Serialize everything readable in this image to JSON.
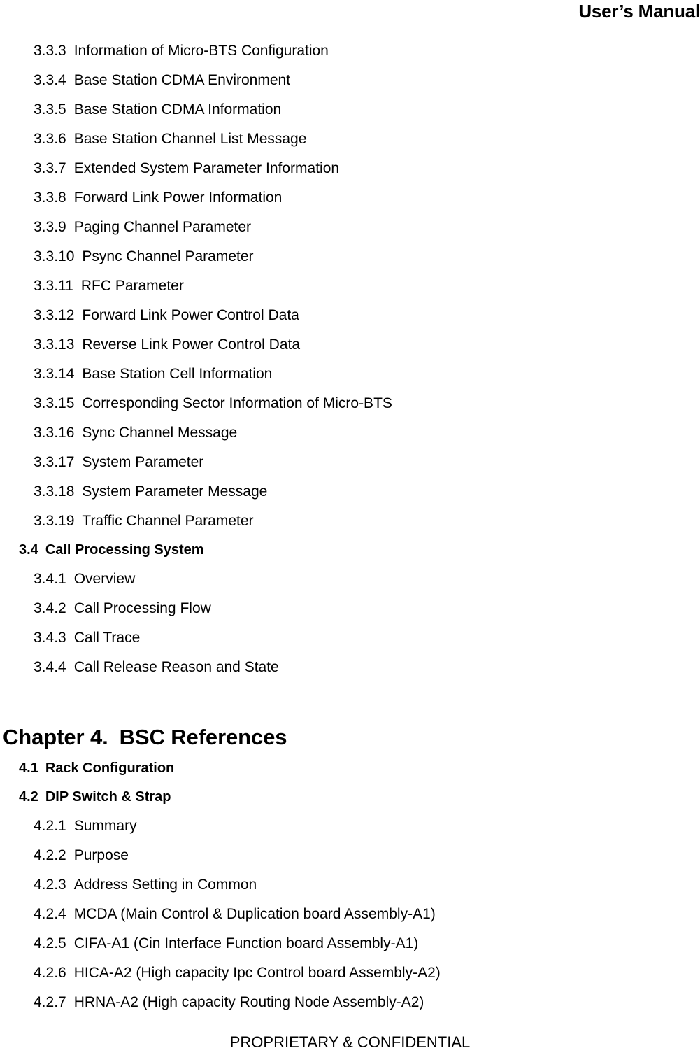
{
  "header": {
    "title": "User’s Manual"
  },
  "toc": {
    "entries": [
      {
        "level": 3,
        "num": "3.3.3",
        "title": "Information of Micro-BTS Configuration"
      },
      {
        "level": 3,
        "num": "3.3.4",
        "title": "Base Station CDMA Environment"
      },
      {
        "level": 3,
        "num": "3.3.5",
        "title": "Base Station CDMA Information"
      },
      {
        "level": 3,
        "num": "3.3.6",
        "title": "Base Station Channel List Message"
      },
      {
        "level": 3,
        "num": "3.3.7",
        "title": "Extended System Parameter Information"
      },
      {
        "level": 3,
        "num": "3.3.8",
        "title": "Forward Link Power Information"
      },
      {
        "level": 3,
        "num": "3.3.9",
        "title": "Paging Channel Parameter"
      },
      {
        "level": 3,
        "num": "3.3.10",
        "title": "Psync Channel Parameter"
      },
      {
        "level": 3,
        "num": "3.3.11",
        "title": "RFC Parameter"
      },
      {
        "level": 3,
        "num": "3.3.12",
        "title": "Forward Link Power Control Data"
      },
      {
        "level": 3,
        "num": "3.3.13",
        "title": "Reverse Link Power Control Data"
      },
      {
        "level": 3,
        "num": "3.3.14",
        "title": "Base Station Cell Information"
      },
      {
        "level": 3,
        "num": "3.3.15",
        "title": "Corresponding Sector Information of Micro-BTS"
      },
      {
        "level": 3,
        "num": "3.3.16",
        "title": "Sync Channel Message"
      },
      {
        "level": 3,
        "num": "3.3.17",
        "title": "System Parameter"
      },
      {
        "level": 3,
        "num": "3.3.18",
        "title": "System Parameter Message"
      },
      {
        "level": 3,
        "num": "3.3.19",
        "title": "Traffic Channel Parameter"
      },
      {
        "level": 2,
        "num": "3.4",
        "title": "Call Processing System"
      },
      {
        "level": 3,
        "num": "3.4.1",
        "title": "Overview"
      },
      {
        "level": 3,
        "num": "3.4.2",
        "title": "Call Processing Flow"
      },
      {
        "level": 3,
        "num": "3.4.3",
        "title": "Call Trace"
      },
      {
        "level": 3,
        "num": "3.4.4",
        "title": "Call Release Reason and State"
      },
      {
        "level": 1,
        "num": "Chapter 4.",
        "title": "BSC References"
      },
      {
        "level": 2,
        "num": "4.1",
        "title": "Rack Configuration"
      },
      {
        "level": 2,
        "num": "4.2",
        "title": "DIP Switch & Strap"
      },
      {
        "level": 3,
        "num": "4.2.1",
        "title": "Summary"
      },
      {
        "level": 3,
        "num": "4.2.2",
        "title": "Purpose"
      },
      {
        "level": 3,
        "num": "4.2.3",
        "title": "Address Setting in Common"
      },
      {
        "level": 3,
        "num": "4.2.4",
        "title": "MCDA (Main Control & Duplication board Assembly-A1)"
      },
      {
        "level": 3,
        "num": "4.2.5",
        "title": "CIFA-A1 (Cin Interface Function board Assembly-A1)"
      },
      {
        "level": 3,
        "num": "4.2.6",
        "title": "HICA-A2 (High capacity Ipc Control board Assembly-A2)"
      },
      {
        "level": 3,
        "num": "4.2.7",
        "title": "HRNA-A2 (High capacity Routing Node Assembly-A2)"
      }
    ]
  },
  "footer": {
    "text": "PROPRIETARY & CONFIDENTIAL"
  }
}
